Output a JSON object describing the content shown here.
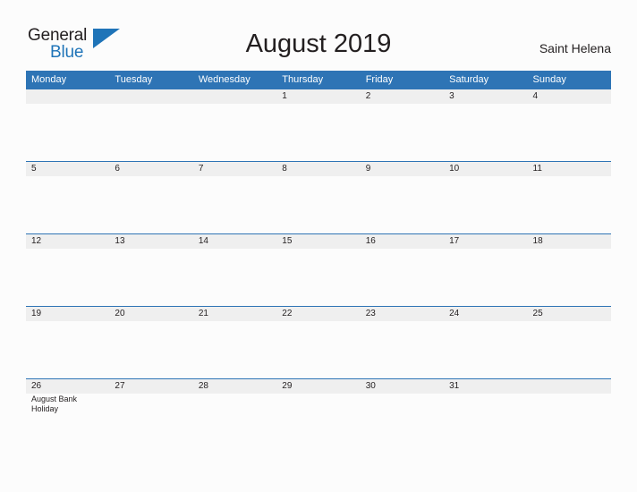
{
  "header": {
    "logo": {
      "word_one": "General",
      "word_two": "Blue",
      "flag_icon": "blue-flag-triangle-icon"
    },
    "title": "August 2019",
    "locale": "Saint Helena"
  },
  "calendar": {
    "weekday_headers": [
      "Monday",
      "Tuesday",
      "Wednesday",
      "Thursday",
      "Friday",
      "Saturday",
      "Sunday"
    ],
    "weeks": [
      [
        {
          "date": "",
          "event": ""
        },
        {
          "date": "",
          "event": ""
        },
        {
          "date": "",
          "event": ""
        },
        {
          "date": "1",
          "event": ""
        },
        {
          "date": "2",
          "event": ""
        },
        {
          "date": "3",
          "event": ""
        },
        {
          "date": "4",
          "event": ""
        }
      ],
      [
        {
          "date": "5",
          "event": ""
        },
        {
          "date": "6",
          "event": ""
        },
        {
          "date": "7",
          "event": ""
        },
        {
          "date": "8",
          "event": ""
        },
        {
          "date": "9",
          "event": ""
        },
        {
          "date": "10",
          "event": ""
        },
        {
          "date": "11",
          "event": ""
        }
      ],
      [
        {
          "date": "12",
          "event": ""
        },
        {
          "date": "13",
          "event": ""
        },
        {
          "date": "14",
          "event": ""
        },
        {
          "date": "15",
          "event": ""
        },
        {
          "date": "16",
          "event": ""
        },
        {
          "date": "17",
          "event": ""
        },
        {
          "date": "18",
          "event": ""
        }
      ],
      [
        {
          "date": "19",
          "event": ""
        },
        {
          "date": "20",
          "event": ""
        },
        {
          "date": "21",
          "event": ""
        },
        {
          "date": "22",
          "event": ""
        },
        {
          "date": "23",
          "event": ""
        },
        {
          "date": "24",
          "event": ""
        },
        {
          "date": "25",
          "event": ""
        }
      ],
      [
        {
          "date": "26",
          "event": "August Bank Holiday"
        },
        {
          "date": "27",
          "event": ""
        },
        {
          "date": "28",
          "event": ""
        },
        {
          "date": "29",
          "event": ""
        },
        {
          "date": "30",
          "event": ""
        },
        {
          "date": "31",
          "event": ""
        },
        {
          "date": "",
          "event": ""
        }
      ],
      [
        {
          "date": "",
          "event": ""
        },
        {
          "date": "",
          "event": ""
        },
        {
          "date": "",
          "event": ""
        },
        {
          "date": "",
          "event": ""
        },
        {
          "date": "",
          "event": ""
        },
        {
          "date": "",
          "event": ""
        },
        {
          "date": "",
          "event": ""
        }
      ]
    ]
  },
  "colors": {
    "header_blue": "#2e74b5",
    "logo_blue": "#1f74b8",
    "band_gray": "#efefef",
    "page_background": "#fcfcfc",
    "text": "#231f20"
  }
}
